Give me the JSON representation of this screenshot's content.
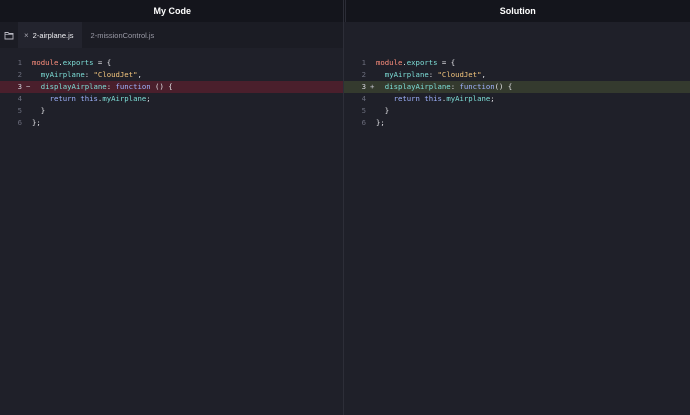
{
  "headers": {
    "my_code": "My Code",
    "solution": "Solution"
  },
  "tabs": [
    {
      "label": "2-airplane.js",
      "active": true,
      "close": "×"
    },
    {
      "label": "2-missionControl.js",
      "active": false
    }
  ],
  "left_code": [
    {
      "num": "1",
      "mark": "",
      "tokens": [
        [
          "mod",
          "module"
        ],
        [
          "punc",
          "."
        ],
        [
          "prop",
          "exports"
        ],
        [
          "punc",
          " = {"
        ]
      ]
    },
    {
      "num": "2",
      "mark": "",
      "tokens": [
        [
          "punc",
          "  "
        ],
        [
          "prop",
          "myAirplane"
        ],
        [
          "punc",
          ": "
        ],
        [
          "str",
          "\"CloudJet\""
        ],
        [
          "punc",
          ","
        ]
      ]
    },
    {
      "num": "3",
      "mark": "−",
      "diff": "del",
      "tokens": [
        [
          "punc",
          "  "
        ],
        [
          "prop",
          "displayAirplane"
        ],
        [
          "punc",
          ": "
        ],
        [
          "kw",
          "function"
        ],
        [
          "punc",
          " () {"
        ]
      ]
    },
    {
      "num": "4",
      "mark": "",
      "tokens": [
        [
          "punc",
          "    "
        ],
        [
          "kw",
          "return"
        ],
        [
          "punc",
          " "
        ],
        [
          "kw",
          "this"
        ],
        [
          "punc",
          "."
        ],
        [
          "prop",
          "myAirplane"
        ],
        [
          "punc",
          ";"
        ]
      ]
    },
    {
      "num": "5",
      "mark": "",
      "tokens": [
        [
          "punc",
          "  }"
        ]
      ]
    },
    {
      "num": "6",
      "mark": "",
      "tokens": [
        [
          "punc",
          "};"
        ]
      ]
    }
  ],
  "right_code": [
    {
      "num": "1",
      "mark": "",
      "tokens": [
        [
          "mod",
          "module"
        ],
        [
          "punc",
          "."
        ],
        [
          "prop",
          "exports"
        ],
        [
          "punc",
          " = {"
        ]
      ]
    },
    {
      "num": "2",
      "mark": "",
      "tokens": [
        [
          "punc",
          "  "
        ],
        [
          "prop",
          "myAirplane"
        ],
        [
          "punc",
          ": "
        ],
        [
          "str",
          "\"CloudJet\""
        ],
        [
          "punc",
          ","
        ]
      ]
    },
    {
      "num": "3",
      "mark": "+",
      "diff": "add",
      "tokens": [
        [
          "punc",
          "  "
        ],
        [
          "prop",
          "displayAirplane"
        ],
        [
          "punc",
          ": "
        ],
        [
          "kw",
          "function"
        ],
        [
          "punc",
          "() {"
        ]
      ]
    },
    {
      "num": "4",
      "mark": "",
      "tokens": [
        [
          "punc",
          "    "
        ],
        [
          "kw",
          "return"
        ],
        [
          "punc",
          " "
        ],
        [
          "kw",
          "this"
        ],
        [
          "punc",
          "."
        ],
        [
          "prop",
          "myAirplane"
        ],
        [
          "punc",
          ";"
        ]
      ]
    },
    {
      "num": "5",
      "mark": "",
      "tokens": [
        [
          "punc",
          "  }"
        ]
      ]
    },
    {
      "num": "6",
      "mark": "",
      "tokens": [
        [
          "punc",
          "};"
        ]
      ]
    }
  ],
  "icons": {
    "folder": "folder-icon",
    "close": "close-icon"
  },
  "colors": {
    "background": "#1f2029",
    "deleted_line": "#4a1f2c",
    "added_line": "#343a2e",
    "keyword": "#9fb3ff",
    "property": "#7ee0d9",
    "string": "#f4c67d",
    "module": "#ff8f7d"
  }
}
